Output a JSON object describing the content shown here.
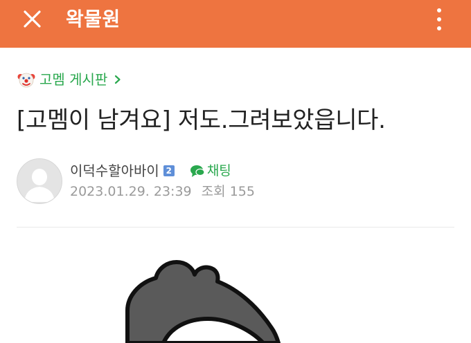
{
  "app": {
    "title": "왁물원",
    "accent_color": "#ee7440",
    "close_icon": "close-icon",
    "menu_icon": "more-vertical-icon"
  },
  "board": {
    "emoji_icon": "clown-face-icon",
    "name": "고멤 게시판",
    "chevron_icon": "chevron-right-icon",
    "link_color": "#2aa84e"
  },
  "post": {
    "title": "[고멤이 남겨요] 저도.그려보았읍니다.",
    "author": "이덕수할아바이",
    "author_level": "2",
    "chat_label": "채팅",
    "date": "2023.01.29. 23:39",
    "views_label": "조회",
    "views": "155"
  }
}
